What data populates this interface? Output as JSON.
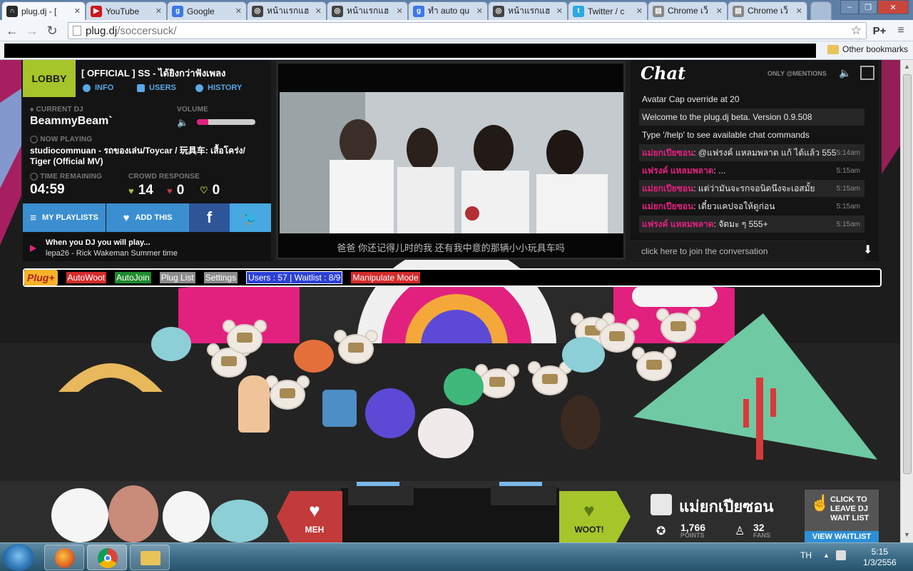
{
  "browser": {
    "tabs": [
      {
        "title": "plug.dj - [",
        "icon": "headphones-icon",
        "color": "#2a2a2a"
      },
      {
        "title": "YouTube",
        "icon": "youtube-icon",
        "color": "#cc181e"
      },
      {
        "title": "Google",
        "icon": "google-icon",
        "color": "#3b78e7"
      },
      {
        "title": "หน้าแรกแฮ",
        "icon": "forum-icon",
        "color": "#444444"
      },
      {
        "title": "หน้าแรกแฮ",
        "icon": "forum-icon",
        "color": "#444444"
      },
      {
        "title": "ทำ auto qu",
        "icon": "google-icon",
        "color": "#3b78e7"
      },
      {
        "title": "หน้าแรกแฮ",
        "icon": "forum-icon",
        "color": "#444444"
      },
      {
        "title": "Twitter / c",
        "icon": "twitter-icon",
        "color": "#2aa9e0"
      },
      {
        "title": "Chrome เว็",
        "icon": "document-icon",
        "color": "#888888"
      },
      {
        "title": "Chrome เว็",
        "icon": "document-icon",
        "color": "#888888"
      }
    ],
    "url_host": "plug.dj",
    "url_path": "/soccersuck/",
    "other_bookmarks": "Other bookmarks"
  },
  "room": {
    "lobby_label": "LOBBY",
    "title": "[ OFFICIAL ] SS - ได้ยิงกว่าฟังเพลง",
    "links": {
      "info": "INFO",
      "users": "USERS",
      "history": "HISTORY"
    },
    "current_dj_label": "CURRENT DJ",
    "current_dj": "BeammyBeam`",
    "volume_label": "VOLUME",
    "volume_level": 0.2,
    "now_playing_label": "NOW PLAYING",
    "now_playing": "studiocommuan - รถของเล่น/Toycar / 玩具车: เสื้อโคร่ง/ Tiger (Official MV)",
    "time_remaining_label": "TIME REMAINING",
    "time_remaining": "04:59",
    "crowd_response_label": "CROWD RESPONSE",
    "woots": "14",
    "mehs": "0",
    "curates": "0",
    "my_playlists": "MY PLAYLISTS",
    "add_this": "ADD THIS",
    "next_up": "When you DJ you will play...",
    "next_track": "lepa26 - Rick Wakeman Summer time"
  },
  "video": {
    "subtitle": "爸爸 你还记得儿时的我 还有我中意的那辆小小玩具车吗"
  },
  "chat": {
    "logo": "Chat",
    "mentions": "ONLY @MENTIONS",
    "messages": [
      {
        "user": "",
        "text": "Avatar Cap override at 20",
        "time": ""
      },
      {
        "user": "",
        "text": "Welcome to the plug.dj beta. Version 0.9.508",
        "time": ""
      },
      {
        "user": "",
        "text": "Type '/help' to see available chat commands",
        "time": ""
      },
      {
        "user": "แม่ยกเปียซอน",
        "text": ": @แฟรงค์ แหลมพลาด แก้ ได้แล้ว 555",
        "time": "5:14am"
      },
      {
        "user": "แฟรงค์ แหลมพลาด",
        "text": ": ...",
        "time": "5:15am"
      },
      {
        "user": "แม่ยกเปียซอน",
        "text": ": แต่ว่ามันจะรกจอนิดนึงจะเอสมั้ย",
        "time": "5:15am"
      },
      {
        "user": "แม่ยกเปียซอน",
        "text": ": เดี๋ยวแคปจอให้ดูก่อน",
        "time": "5:15am"
      },
      {
        "user": "แฟรงค์ แหลมพลาด",
        "text": ": จัดมะ ๆ 555+",
        "time": "5:15am"
      }
    ],
    "input_placeholder": "click here to join the conversation"
  },
  "plugplus": {
    "logo": "Plug+",
    "buttons": [
      {
        "label": "AutoWoot",
        "bg": "#d42b2b"
      },
      {
        "label": "AutoJoin",
        "bg": "#1f8a2e"
      },
      {
        "label": "Plug List",
        "bg": "#8c8c8c"
      },
      {
        "label": "Settings",
        "bg": "#8c8c8c"
      },
      {
        "label": "Users : 57 | Waitlist : 8/9",
        "bg": "#2b3fd4"
      },
      {
        "label": "Manipulate Mode",
        "bg": "#d42b2b"
      }
    ]
  },
  "booth": {
    "meh_label": "MEH",
    "woot_label": "WOOT!",
    "dj_name": "แม่ยกเปียซอน",
    "points": "1,766",
    "points_label": "POINTS",
    "fans": "32",
    "fans_label": "FANS",
    "leave_dj": "CLICK TO LEAVE DJ WAIT LIST",
    "view_waitlist": "VIEW WAITLIST"
  },
  "taskbar": {
    "language": "TH",
    "time": "5:15",
    "date": "1/3/2556"
  },
  "colors": {
    "accent_pink": "#e2217f",
    "woot_green": "#a6c52b",
    "meh_red": "#c23a3a",
    "link_blue": "#5aa8e6"
  }
}
